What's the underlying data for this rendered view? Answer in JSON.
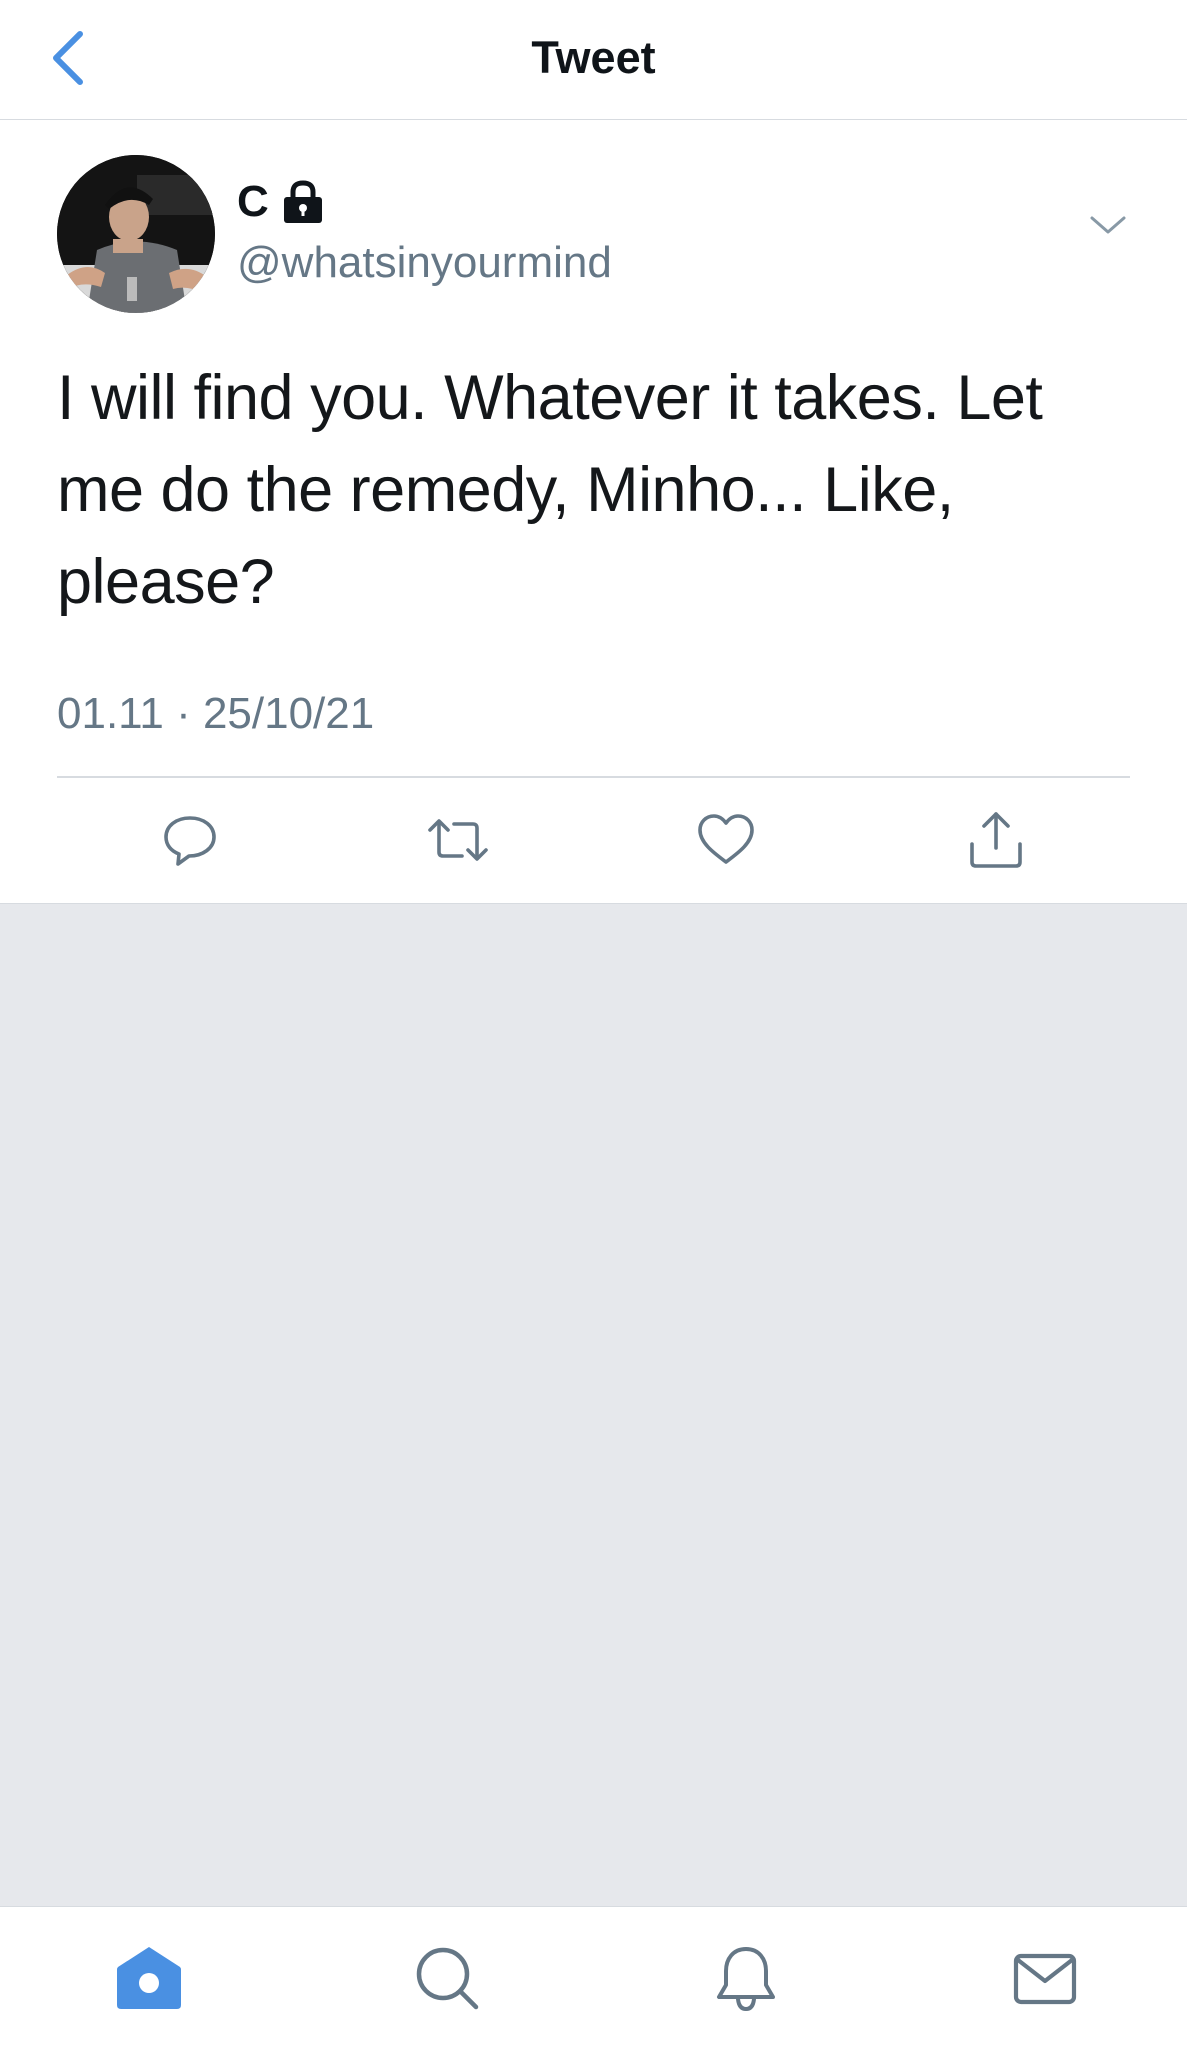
{
  "header": {
    "title": "Tweet",
    "back_icon": "chevron-left-icon"
  },
  "tweet": {
    "display_name": "C",
    "protected_icon": "lock-icon",
    "handle": "@whatsinyourmind",
    "text": "I will find you. Whatever it takes. Let me do the remedy, Minho... Like, please?",
    "timestamp": "01.11 · 25/10/21",
    "menu_icon": "chevron-down-icon",
    "actions": [
      "reply-icon",
      "retweet-icon",
      "like-icon",
      "share-icon"
    ]
  },
  "tabbar": {
    "items": [
      "home-icon",
      "search-icon",
      "notifications-icon",
      "messages-icon"
    ],
    "active": "home-icon"
  },
  "colors": {
    "accent": "#4a90e2",
    "secondary_text": "#657786",
    "icon_gray": "#657786",
    "empty_bg": "#e6e8ec"
  }
}
